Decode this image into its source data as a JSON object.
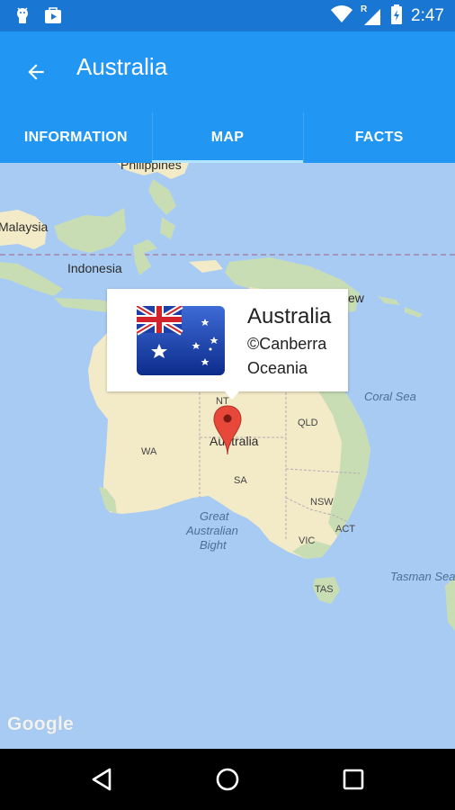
{
  "status_bar": {
    "time": "2:47",
    "left_icons": [
      "android-debug-icon",
      "play-store-icon"
    ],
    "right_icons": [
      "wifi-icon",
      "signal-roaming-icon",
      "battery-icon"
    ],
    "roaming_indicator": "R"
  },
  "app_bar": {
    "title": "Australia",
    "back_icon": "arrow-back-icon"
  },
  "tabs": [
    {
      "label": "INFORMATION",
      "active": false
    },
    {
      "label": "MAP",
      "active": true
    },
    {
      "label": "FACTS",
      "active": false
    }
  ],
  "map": {
    "labels": {
      "philippines": "Philippines",
      "malaysia": "Malaysia",
      "indonesia": "Indonesia",
      "new_partial": "ew",
      "coral_sea": "Coral Sea",
      "australia": "Australia",
      "wa": "WA",
      "nt": "NT",
      "qld": "QLD",
      "sa": "SA",
      "nsw": "NSW",
      "act": "ACT",
      "vic": "VIC",
      "tas": "TAS",
      "great": "Great",
      "australian": "Australian",
      "bight": "Bight",
      "tasman_sea": "Tasman Sea"
    },
    "attribution": "Google",
    "info_window": {
      "name": "Australia",
      "capital": "©Canberra",
      "region": "Oceania"
    },
    "colors": {
      "water": "#A8CBF3",
      "land": "#F3EBC8",
      "vegetation": "#C9DDB5",
      "marker": "#E8483A"
    }
  },
  "nav_bar": {
    "buttons": [
      "back-triangle-icon",
      "home-circle-icon",
      "recents-square-icon"
    ]
  }
}
